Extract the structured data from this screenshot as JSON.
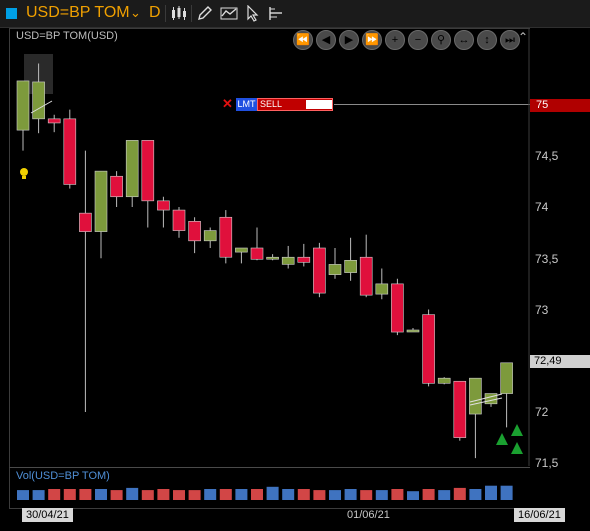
{
  "toolbar": {
    "symbol": "USD=BP TOM",
    "period": "D",
    "tools": [
      "candlestick-icon",
      "pencil-icon",
      "chart-type-icon",
      "cursor-icon",
      "crosshair-icon"
    ]
  },
  "chart": {
    "title": "USD=BP TOM(USD)",
    "volume_title": "Vol(USD=BP TOM)",
    "nav_buttons": [
      "rewind-icon",
      "back-icon",
      "forward-icon",
      "fast-forward-icon",
      "zoom-in-icon",
      "zoom-out-icon",
      "zoom-fit-icon",
      "pan-horizontal-icon",
      "pan-vertical-icon",
      "end-icon"
    ],
    "y_labels": [
      "74,5",
      "74",
      "73,5",
      "73",
      "72",
      "71,5"
    ],
    "price_marker": "75",
    "last_price": "72,49",
    "x_labels": {
      "start": "30/04/21",
      "mid": "01/06/21",
      "end": "16/06/21"
    }
  },
  "order": {
    "type": "LMT",
    "side": "SELL"
  },
  "colors": {
    "up": "#7d9a3c",
    "down": "#e0103c",
    "vol_up": "#3f73c0",
    "vol_down": "#d24646"
  },
  "chart_data": {
    "type": "candlestick",
    "ylim": [
      71.4,
      75.4
    ],
    "candles": [
      {
        "o": 74.75,
        "h": 75.0,
        "l": 74.55,
        "c": 75.23
      },
      {
        "o": 74.86,
        "h": 75.4,
        "l": 74.72,
        "c": 75.22
      },
      {
        "o": 74.86,
        "h": 74.9,
        "l": 74.73,
        "c": 74.82
      },
      {
        "o": 74.86,
        "h": 74.95,
        "l": 74.18,
        "c": 74.22
      },
      {
        "o": 73.94,
        "h": 74.55,
        "l": 72.0,
        "c": 73.76
      },
      {
        "o": 73.76,
        "h": 74.35,
        "l": 73.5,
        "c": 74.35
      },
      {
        "o": 74.3,
        "h": 74.35,
        "l": 74.0,
        "c": 74.1
      },
      {
        "o": 74.1,
        "h": 74.65,
        "l": 74.0,
        "c": 74.65
      },
      {
        "o": 74.65,
        "h": 74.65,
        "l": 73.8,
        "c": 74.06
      },
      {
        "o": 74.06,
        "h": 74.1,
        "l": 73.8,
        "c": 73.97
      },
      {
        "o": 73.97,
        "h": 74.0,
        "l": 73.7,
        "c": 73.77
      },
      {
        "o": 73.86,
        "h": 73.9,
        "l": 73.55,
        "c": 73.67
      },
      {
        "o": 73.67,
        "h": 73.8,
        "l": 73.6,
        "c": 73.77
      },
      {
        "o": 73.9,
        "h": 73.97,
        "l": 73.45,
        "c": 73.51
      },
      {
        "o": 73.56,
        "h": 73.6,
        "l": 73.45,
        "c": 73.6
      },
      {
        "o": 73.6,
        "h": 73.8,
        "l": 73.48,
        "c": 73.49
      },
      {
        "o": 73.5,
        "h": 73.54,
        "l": 73.48,
        "c": 73.51
      },
      {
        "o": 73.44,
        "h": 73.62,
        "l": 73.4,
        "c": 73.51
      },
      {
        "o": 73.51,
        "h": 73.64,
        "l": 73.42,
        "c": 73.46
      },
      {
        "o": 73.6,
        "h": 73.65,
        "l": 73.12,
        "c": 73.16
      },
      {
        "o": 73.34,
        "h": 73.6,
        "l": 73.3,
        "c": 73.44
      },
      {
        "o": 73.36,
        "h": 73.7,
        "l": 73.28,
        "c": 73.48
      },
      {
        "o": 73.51,
        "h": 73.73,
        "l": 73.12,
        "c": 73.14
      },
      {
        "o": 73.15,
        "h": 73.4,
        "l": 73.1,
        "c": 73.25
      },
      {
        "o": 73.25,
        "h": 73.3,
        "l": 72.75,
        "c": 72.78
      },
      {
        "o": 72.8,
        "h": 72.82,
        "l": 72.78,
        "c": 72.8
      },
      {
        "o": 72.95,
        "h": 73.0,
        "l": 72.25,
        "c": 72.28
      },
      {
        "o": 72.28,
        "h": 72.34,
        "l": 72.27,
        "c": 72.33
      },
      {
        "o": 72.3,
        "h": 72.3,
        "l": 71.72,
        "c": 71.75
      },
      {
        "o": 71.98,
        "h": 72.25,
        "l": 71.55,
        "c": 72.33
      },
      {
        "o": 72.08,
        "h": 72.15,
        "l": 72.05,
        "c": 72.18
      },
      {
        "o": 72.18,
        "h": 72.35,
        "l": 71.85,
        "c": 72.48
      }
    ],
    "volumes": [
      0.45,
      0.45,
      0.5,
      0.5,
      0.5,
      0.5,
      0.45,
      0.55,
      0.45,
      0.5,
      0.45,
      0.45,
      0.5,
      0.5,
      0.5,
      0.5,
      0.6,
      0.5,
      0.5,
      0.45,
      0.45,
      0.5,
      0.45,
      0.45,
      0.5,
      0.4,
      0.5,
      0.45,
      0.55,
      0.5,
      0.65,
      0.65
    ],
    "xlabels": [
      "30/04/21",
      "01/06/21",
      "16/06/21"
    ],
    "signals": "buy arrows at last two bars"
  }
}
